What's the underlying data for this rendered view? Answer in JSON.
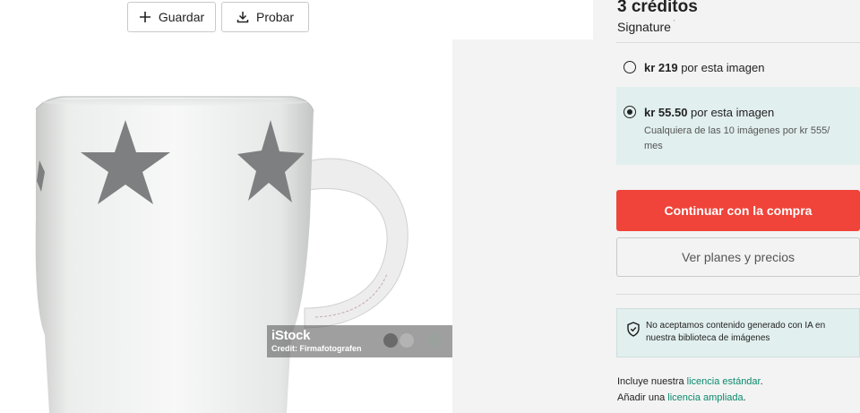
{
  "toolbar": {
    "save_label": "Guardar",
    "try_label": "Probar"
  },
  "image": {
    "watermark_logo": "iStock",
    "watermark_credit": "Credit: Firmafotografen"
  },
  "pricing": {
    "credits": "3 créditos",
    "tier": "Signature",
    "tier_mark": "'",
    "options": [
      {
        "price": "kr 219",
        "text": " por esta imagen",
        "selected": false
      },
      {
        "price": "kr 55.50",
        "text": " por esta imagen",
        "sub": "Cualquiera de las 10 imágenes por kr 555/ mes",
        "selected": true
      }
    ],
    "continue_label": "Continuar con la compra",
    "plans_label": "Ver planes y precios"
  },
  "notice": {
    "text": "No aceptamos contenido generado con IA en nuestra biblioteca de imágenes"
  },
  "license": {
    "line1_prefix": "Incluye nuestra ",
    "line1_link": "licencia estándar",
    "line1_suffix": ".",
    "line2_prefix": "Añadir una ",
    "line2_link": "licencia ampliada",
    "line2_suffix": "."
  },
  "colors": {
    "accent_red": "#f04339",
    "link_green": "#0a8a6e",
    "selected_bg": "#e1efee"
  }
}
